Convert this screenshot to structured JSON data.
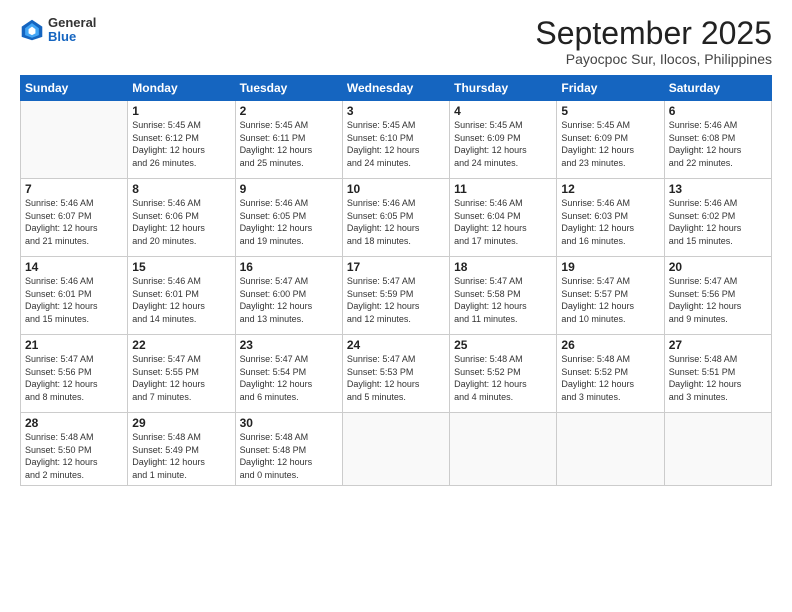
{
  "logo": {
    "general": "General",
    "blue": "Blue"
  },
  "header": {
    "title": "September 2025",
    "location": "Payocpoc Sur, Ilocos, Philippines"
  },
  "weekdays": [
    "Sunday",
    "Monday",
    "Tuesday",
    "Wednesday",
    "Thursday",
    "Friday",
    "Saturday"
  ],
  "weeks": [
    [
      {
        "day": "",
        "info": ""
      },
      {
        "day": "1",
        "info": "Sunrise: 5:45 AM\nSunset: 6:12 PM\nDaylight: 12 hours\nand 26 minutes."
      },
      {
        "day": "2",
        "info": "Sunrise: 5:45 AM\nSunset: 6:11 PM\nDaylight: 12 hours\nand 25 minutes."
      },
      {
        "day": "3",
        "info": "Sunrise: 5:45 AM\nSunset: 6:10 PM\nDaylight: 12 hours\nand 24 minutes."
      },
      {
        "day": "4",
        "info": "Sunrise: 5:45 AM\nSunset: 6:09 PM\nDaylight: 12 hours\nand 24 minutes."
      },
      {
        "day": "5",
        "info": "Sunrise: 5:45 AM\nSunset: 6:09 PM\nDaylight: 12 hours\nand 23 minutes."
      },
      {
        "day": "6",
        "info": "Sunrise: 5:46 AM\nSunset: 6:08 PM\nDaylight: 12 hours\nand 22 minutes."
      }
    ],
    [
      {
        "day": "7",
        "info": "Sunrise: 5:46 AM\nSunset: 6:07 PM\nDaylight: 12 hours\nand 21 minutes."
      },
      {
        "day": "8",
        "info": "Sunrise: 5:46 AM\nSunset: 6:06 PM\nDaylight: 12 hours\nand 20 minutes."
      },
      {
        "day": "9",
        "info": "Sunrise: 5:46 AM\nSunset: 6:05 PM\nDaylight: 12 hours\nand 19 minutes."
      },
      {
        "day": "10",
        "info": "Sunrise: 5:46 AM\nSunset: 6:05 PM\nDaylight: 12 hours\nand 18 minutes."
      },
      {
        "day": "11",
        "info": "Sunrise: 5:46 AM\nSunset: 6:04 PM\nDaylight: 12 hours\nand 17 minutes."
      },
      {
        "day": "12",
        "info": "Sunrise: 5:46 AM\nSunset: 6:03 PM\nDaylight: 12 hours\nand 16 minutes."
      },
      {
        "day": "13",
        "info": "Sunrise: 5:46 AM\nSunset: 6:02 PM\nDaylight: 12 hours\nand 15 minutes."
      }
    ],
    [
      {
        "day": "14",
        "info": "Sunrise: 5:46 AM\nSunset: 6:01 PM\nDaylight: 12 hours\nand 15 minutes."
      },
      {
        "day": "15",
        "info": "Sunrise: 5:46 AM\nSunset: 6:01 PM\nDaylight: 12 hours\nand 14 minutes."
      },
      {
        "day": "16",
        "info": "Sunrise: 5:47 AM\nSunset: 6:00 PM\nDaylight: 12 hours\nand 13 minutes."
      },
      {
        "day": "17",
        "info": "Sunrise: 5:47 AM\nSunset: 5:59 PM\nDaylight: 12 hours\nand 12 minutes."
      },
      {
        "day": "18",
        "info": "Sunrise: 5:47 AM\nSunset: 5:58 PM\nDaylight: 12 hours\nand 11 minutes."
      },
      {
        "day": "19",
        "info": "Sunrise: 5:47 AM\nSunset: 5:57 PM\nDaylight: 12 hours\nand 10 minutes."
      },
      {
        "day": "20",
        "info": "Sunrise: 5:47 AM\nSunset: 5:56 PM\nDaylight: 12 hours\nand 9 minutes."
      }
    ],
    [
      {
        "day": "21",
        "info": "Sunrise: 5:47 AM\nSunset: 5:56 PM\nDaylight: 12 hours\nand 8 minutes."
      },
      {
        "day": "22",
        "info": "Sunrise: 5:47 AM\nSunset: 5:55 PM\nDaylight: 12 hours\nand 7 minutes."
      },
      {
        "day": "23",
        "info": "Sunrise: 5:47 AM\nSunset: 5:54 PM\nDaylight: 12 hours\nand 6 minutes."
      },
      {
        "day": "24",
        "info": "Sunrise: 5:47 AM\nSunset: 5:53 PM\nDaylight: 12 hours\nand 5 minutes."
      },
      {
        "day": "25",
        "info": "Sunrise: 5:48 AM\nSunset: 5:52 PM\nDaylight: 12 hours\nand 4 minutes."
      },
      {
        "day": "26",
        "info": "Sunrise: 5:48 AM\nSunset: 5:52 PM\nDaylight: 12 hours\nand 3 minutes."
      },
      {
        "day": "27",
        "info": "Sunrise: 5:48 AM\nSunset: 5:51 PM\nDaylight: 12 hours\nand 3 minutes."
      }
    ],
    [
      {
        "day": "28",
        "info": "Sunrise: 5:48 AM\nSunset: 5:50 PM\nDaylight: 12 hours\nand 2 minutes."
      },
      {
        "day": "29",
        "info": "Sunrise: 5:48 AM\nSunset: 5:49 PM\nDaylight: 12 hours\nand 1 minute."
      },
      {
        "day": "30",
        "info": "Sunrise: 5:48 AM\nSunset: 5:48 PM\nDaylight: 12 hours\nand 0 minutes."
      },
      {
        "day": "",
        "info": ""
      },
      {
        "day": "",
        "info": ""
      },
      {
        "day": "",
        "info": ""
      },
      {
        "day": "",
        "info": ""
      }
    ]
  ]
}
